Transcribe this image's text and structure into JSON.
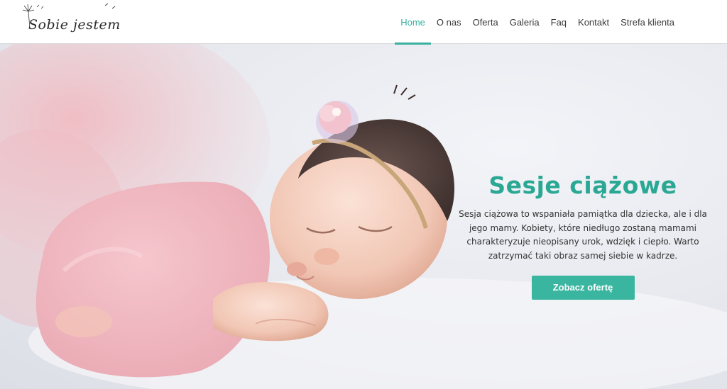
{
  "brand": {
    "logo_text": "Sobie jestem"
  },
  "nav": {
    "items": [
      {
        "label": "Home",
        "active": true
      },
      {
        "label": "O nas",
        "active": false
      },
      {
        "label": "Oferta",
        "active": false
      },
      {
        "label": "Galeria",
        "active": false
      },
      {
        "label": "Faq",
        "active": false
      },
      {
        "label": "Kontakt",
        "active": false
      },
      {
        "label": "Strefa klienta",
        "active": false
      }
    ]
  },
  "hero": {
    "title": "Sesje ciążowe",
    "text": "Sesja ciążowa to wspaniała pamiątka dla dziecka, ale i dla jego mamy. Kobiety, które niedługo zostaną mamami charakteryzuje nieopisany urok, wdzięk i ciepło. Warto zatrzymać taki obraz samej siebie w kadrze.",
    "cta_label": "Zobacz ofertę"
  },
  "colors": {
    "accent": "#3ab09e",
    "button": "#3ab5a0",
    "title": "#2aa894"
  }
}
